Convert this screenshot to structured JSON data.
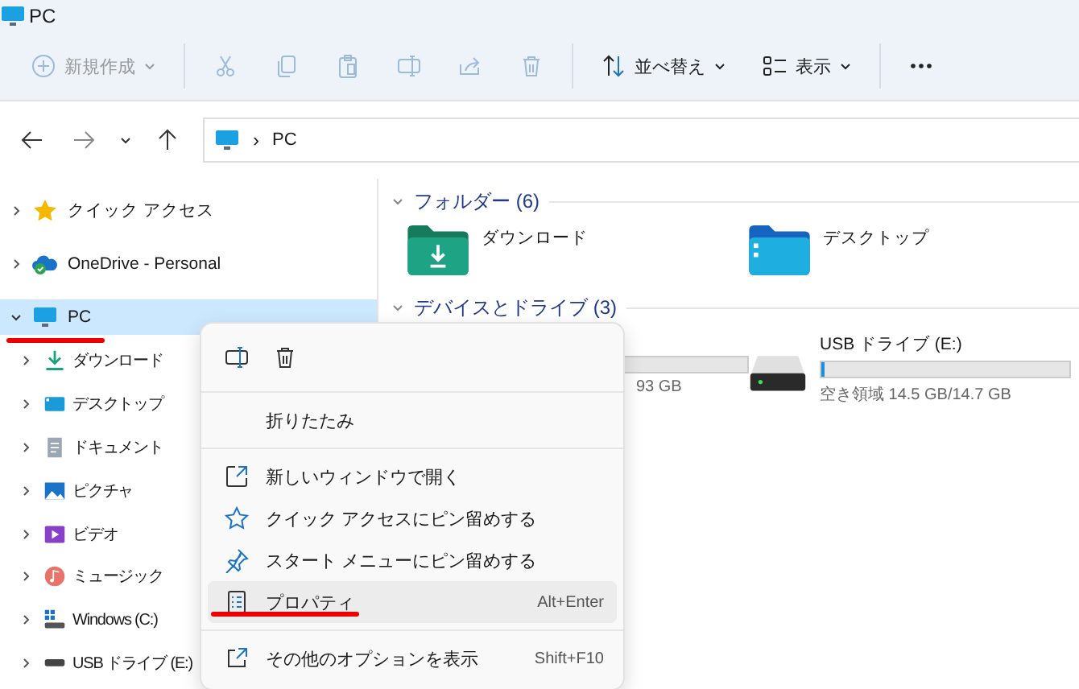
{
  "window": {
    "title": "PC"
  },
  "toolbar": [
    {
      "kind": "new",
      "label": "新規作成",
      "disabled": true
    },
    {
      "kind": "cut",
      "disabled": true
    },
    {
      "kind": "copy",
      "disabled": true
    },
    {
      "kind": "paste",
      "disabled": true
    },
    {
      "kind": "rename",
      "disabled": true
    },
    {
      "kind": "share",
      "disabled": true
    },
    {
      "kind": "delete",
      "disabled": true
    },
    {
      "kind": "sort",
      "label": "並べ替え",
      "disabled": false
    },
    {
      "kind": "view",
      "label": "表示",
      "disabled": false
    },
    {
      "kind": "more",
      "disabled": false
    }
  ],
  "address": {
    "separator": "›",
    "path": "PC"
  },
  "sidebar": {
    "items": [
      {
        "kind": "star",
        "label": "クイック アクセス",
        "expanded": false,
        "selected": false
      },
      {
        "kind": "cloud",
        "label": "OneDrive - Personal",
        "expanded": false,
        "selected": false
      },
      {
        "kind": "pc",
        "label": "PC",
        "expanded": true,
        "selected": true,
        "children": [
          {
            "kind": "download",
            "label": "ダウンロード",
            "expanded": false,
            "selected": false
          },
          {
            "kind": "desktop",
            "label": "デスクトップ",
            "expanded": false,
            "selected": false
          },
          {
            "kind": "document",
            "label": "ドキュメント",
            "expanded": false,
            "selected": false
          },
          {
            "kind": "picture",
            "label": "ピクチャ",
            "expanded": false,
            "selected": false
          },
          {
            "kind": "video",
            "label": "ビデオ",
            "expanded": false,
            "selected": false
          },
          {
            "kind": "music",
            "label": "ミュージック",
            "expanded": false,
            "selected": false
          },
          {
            "kind": "windows",
            "label": "Windows (C:)",
            "expanded": false,
            "selected": false
          },
          {
            "kind": "usb",
            "label": "USB ドライブ (E:)",
            "expanded": false,
            "selected": false
          }
        ]
      }
    ]
  },
  "folders": {
    "title": "フォルダー (6)",
    "items": [
      {
        "kind": "download",
        "label": "ダウンロード"
      },
      {
        "kind": "desktop",
        "label": "デスクトップ"
      }
    ]
  },
  "drives": {
    "title": "デバイスとドライブ (3)",
    "items": [
      {
        "kind": "partial",
        "usage": "93 GB"
      },
      {
        "kind": "usb",
        "label": "USB ドライブ (E:)",
        "level": 0.015,
        "usage": "空き領域 14.5 GB/14.7 GB"
      }
    ]
  },
  "context_menu": {
    "actions": [
      {
        "kind": "rename"
      },
      {
        "kind": "delete"
      }
    ],
    "items": [
      {
        "kind": "plain",
        "label": "折りたたみ",
        "selected": false
      },
      {
        "kind": "separator"
      },
      {
        "kind": "open",
        "label": "新しいウィンドウで開く",
        "selected": false
      },
      {
        "kind": "star",
        "label": "クイック アクセスにピン留めする",
        "selected": false
      },
      {
        "kind": "pin",
        "label": "スタート メニューにピン留めする",
        "selected": false
      },
      {
        "kind": "props",
        "label": "プロパティ",
        "shortcut": "Alt+Enter",
        "selected": true
      },
      {
        "kind": "separator"
      },
      {
        "kind": "more",
        "label": "その他のオプションを表示",
        "shortcut": "Shift+F10",
        "selected": false
      }
    ]
  }
}
